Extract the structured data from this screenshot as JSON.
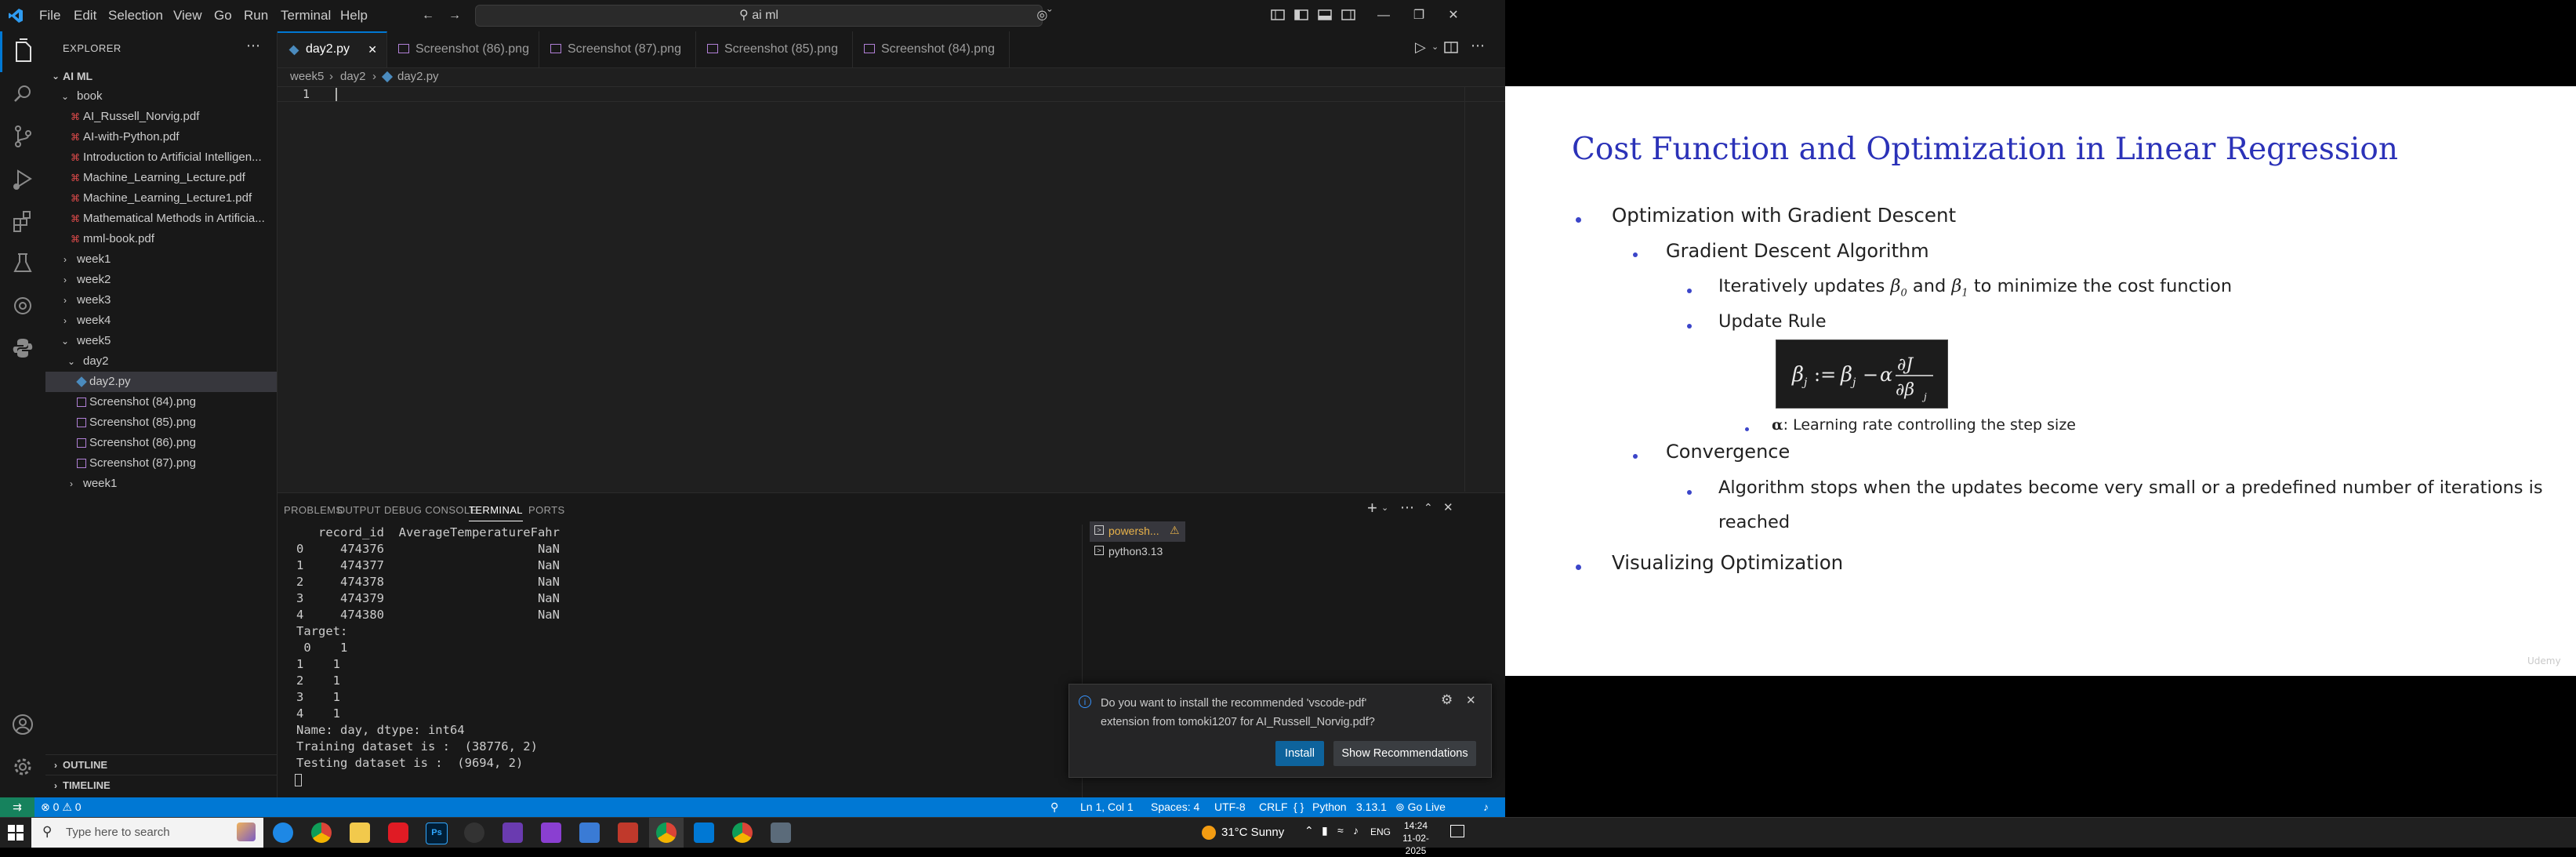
{
  "titlebar": {
    "menus": [
      "File",
      "Edit",
      "Selection",
      "View",
      "Go",
      "Run",
      "Terminal",
      "Help"
    ],
    "search_text": "ai ml"
  },
  "sidebar": {
    "header": "EXPLORER",
    "root": "AI ML",
    "items": [
      {
        "label": "book",
        "type": "folder",
        "open": true,
        "depth": 1
      },
      {
        "label": "AI_Russell_Norvig.pdf",
        "type": "pdf",
        "depth": 2
      },
      {
        "label": "AI-with-Python.pdf",
        "type": "pdf",
        "depth": 2
      },
      {
        "label": "Introduction to Artificial Intelligen...",
        "type": "pdf",
        "depth": 2
      },
      {
        "label": "Machine_Learning_Lecture.pdf",
        "type": "pdf",
        "depth": 2
      },
      {
        "label": "Machine_Learning_Lecture1.pdf",
        "type": "pdf",
        "depth": 2
      },
      {
        "label": "Mathematical Methods in Artificia...",
        "type": "pdf",
        "depth": 2
      },
      {
        "label": "mml-book.pdf",
        "type": "pdf",
        "depth": 2
      },
      {
        "label": "week1",
        "type": "folder",
        "open": false,
        "depth": 1
      },
      {
        "label": "week2",
        "type": "folder",
        "open": false,
        "depth": 1
      },
      {
        "label": "week3",
        "type": "folder",
        "open": false,
        "depth": 1
      },
      {
        "label": "week4",
        "type": "folder",
        "open": false,
        "depth": 1
      },
      {
        "label": "week5",
        "type": "folder",
        "open": true,
        "depth": 1
      },
      {
        "label": "day2",
        "type": "folder",
        "open": true,
        "depth": 2
      },
      {
        "label": "day2.py",
        "type": "py",
        "depth": 3,
        "selected": true
      },
      {
        "label": "Screenshot (84).png",
        "type": "png",
        "depth": 3
      },
      {
        "label": "Screenshot (85).png",
        "type": "png",
        "depth": 3
      },
      {
        "label": "Screenshot (86).png",
        "type": "png",
        "depth": 3
      },
      {
        "label": "Screenshot (87).png",
        "type": "png",
        "depth": 3
      },
      {
        "label": "week1",
        "type": "folder",
        "open": false,
        "depth": 2
      }
    ],
    "outline": "OUTLINE",
    "timeline": "TIMELINE"
  },
  "tabs": [
    {
      "label": "day2.py",
      "type": "py",
      "active": true
    },
    {
      "label": "Screenshot (86).png",
      "type": "png"
    },
    {
      "label": "Screenshot (87).png",
      "type": "png"
    },
    {
      "label": "Screenshot (85).png",
      "type": "png"
    },
    {
      "label": "Screenshot (84).png",
      "type": "png"
    }
  ],
  "breadcrumb": [
    "week5",
    "day2",
    "day2.py"
  ],
  "editor": {
    "line_number": "1"
  },
  "panel": {
    "tabs": [
      "PROBLEMS",
      "OUTPUT",
      "DEBUG CONSOLE",
      "TERMINAL",
      "PORTS"
    ],
    "active_tab": "TERMINAL",
    "terminal_lines": [
      "   record_id  AverageTemperatureFahr",
      "0     474376                     NaN",
      "1     474377                     NaN",
      "2     474378                     NaN",
      "3     474379                     NaN",
      "4     474380                     NaN",
      "Target:",
      " 0    1",
      "1    1",
      "2    1",
      "3    1",
      "4    1",
      "Name: day, dtype: int64",
      "Training dataset is :  (38776, 2)",
      "Testing dataset is :  (9694, 2)"
    ],
    "sessions": [
      "powersh...",
      "python3.13"
    ]
  },
  "notification": {
    "message_line1": "Do you want to install the recommended 'vscode-pdf'",
    "message_line2": "extension from tomoki1207 for AI_Russell_Norvig.pdf?",
    "install_label": "Install",
    "recommend_label": "Show Recommendations"
  },
  "statusbar": {
    "errors": "0",
    "warnings": "0",
    "position": "Ln 1, Col 1",
    "spaces": "Spaces: 4",
    "encoding": "UTF-8",
    "eol": "CRLF",
    "language": "Python",
    "version": "3.13.1",
    "golive": "Go Live"
  },
  "slide": {
    "title": "Cost Function and Optimization in Linear Regression",
    "l1": "Optimization with Gradient Descent",
    "l2": "Gradient Descent Algorithm",
    "l3a_pre": "Iteratively updates",
    "l3a_and": "and",
    "l3a_post": "to minimize the cost function",
    "l3b": "Update Rule",
    "alpha_note": ": Learning rate controlling the step size",
    "convergence": "Convergence",
    "conv_detail_1": "Algorithm stops when the updates become very small or a predefined number of iterations is",
    "conv_detail_2": "reached",
    "visualizing": "Visualizing Optimization",
    "watermark": "Udemy"
  },
  "taskbar": {
    "search_placeholder": "Type here to search",
    "weather": "31°C  Sunny",
    "lang": "ENG",
    "time": "14:24",
    "date": "11-02-2025"
  },
  "colors": {
    "accent": "#0078d4",
    "slide_title": "#2b32b8",
    "bullet": "#3b45c9"
  }
}
